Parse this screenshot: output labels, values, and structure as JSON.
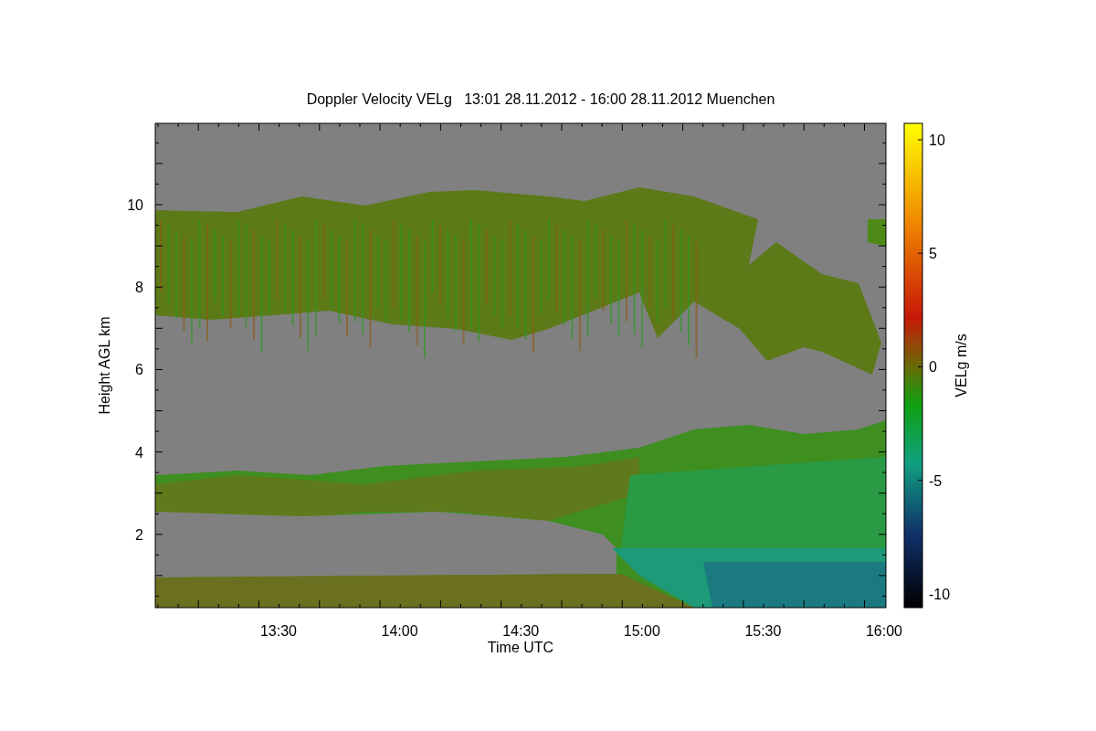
{
  "figure": {
    "title": "Doppler Velocity VELg   13:01 28.11.2012 - 16:00 28.11.2012 Muenchen",
    "x_axis": {
      "label": "Time UTC",
      "ticks": [
        "13:30",
        "14:00",
        "14:30",
        "15:00",
        "15:30",
        "16:00"
      ]
    },
    "y_axis": {
      "label": "Height AGL km",
      "ticks": [
        "10",
        "8",
        "6",
        "4",
        "2"
      ]
    },
    "colorbar": {
      "label": "VELg m/s",
      "ticks": [
        "10",
        "5",
        "0",
        "-5",
        "-10"
      ]
    }
  }
}
